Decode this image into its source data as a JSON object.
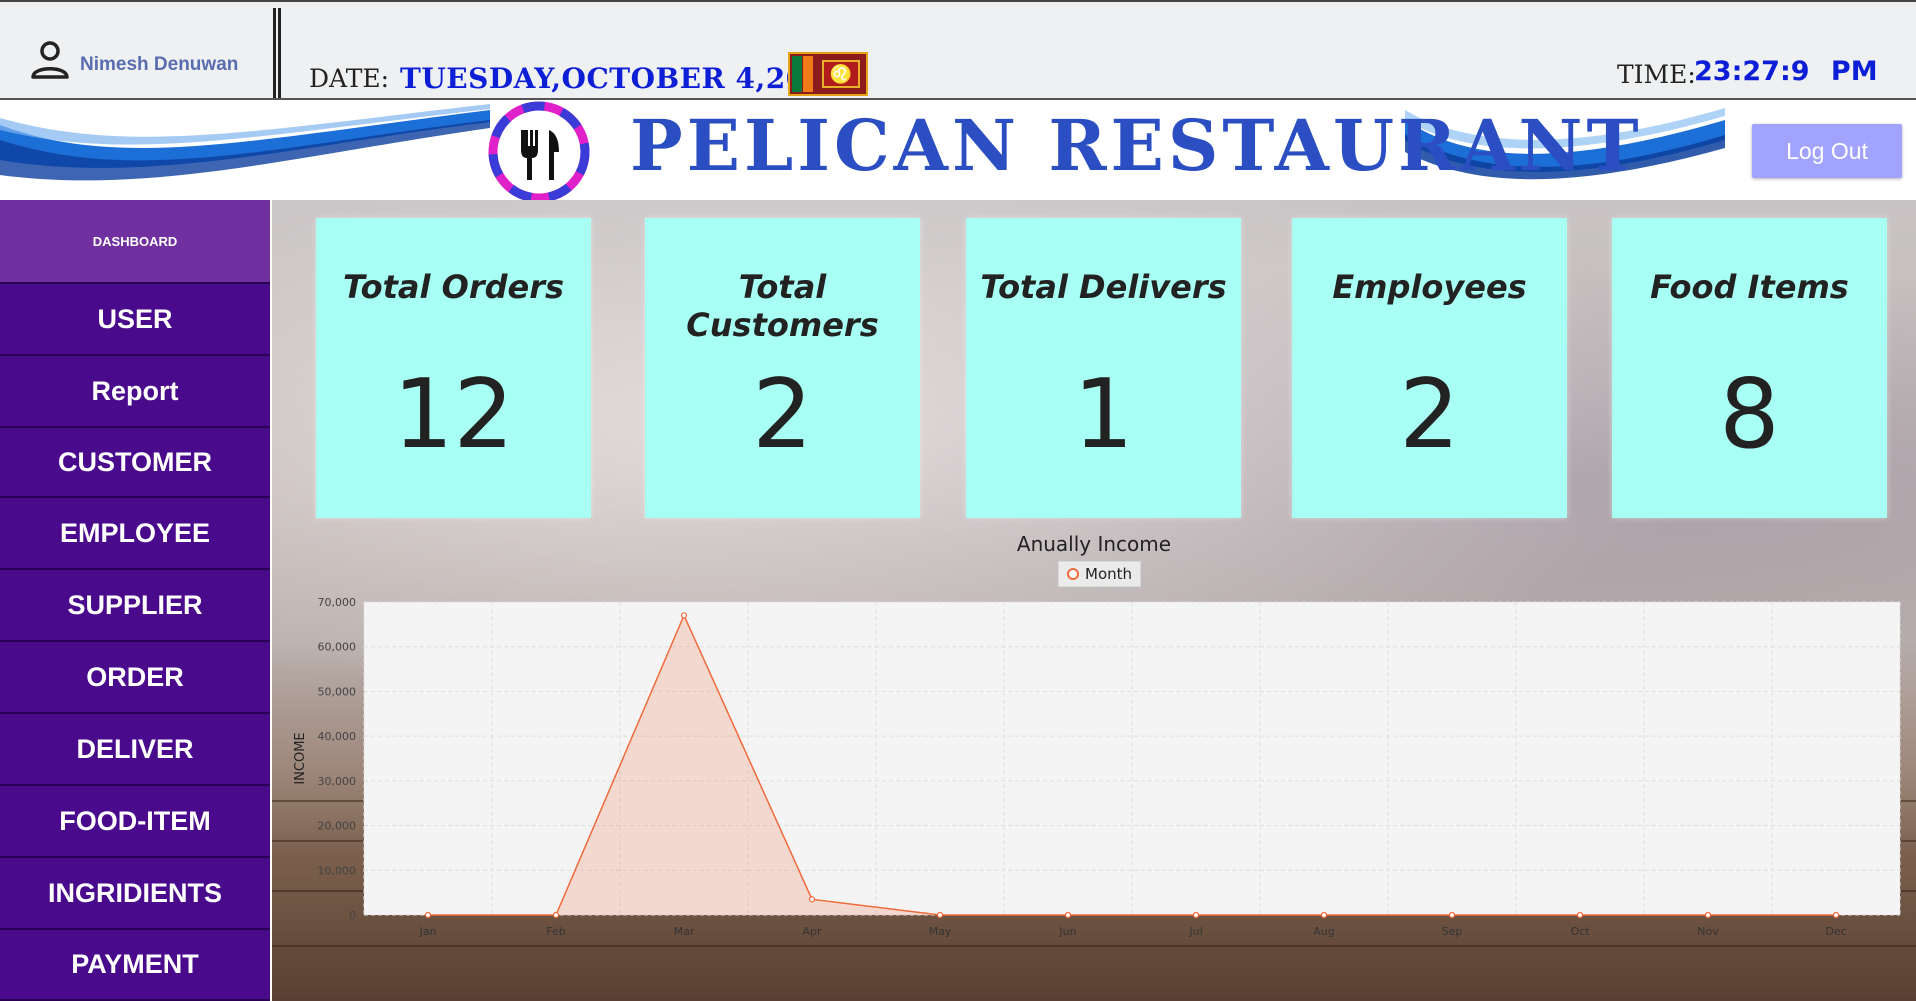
{
  "header": {
    "user_name": "Nimesh Denuwan",
    "date_label": "DATE:",
    "date_value": "TUESDAY,OCTOBER 4,2022",
    "time_label": "TIME:",
    "time_value": "23:27:9  PM"
  },
  "banner": {
    "title": "PELICAN RESTAURANT",
    "logout_label": "Log Out"
  },
  "sidebar": {
    "items": [
      {
        "label": "DASHBOARD"
      },
      {
        "label": "USER"
      },
      {
        "label": "Report"
      },
      {
        "label": "CUSTOMER"
      },
      {
        "label": "EMPLOYEE"
      },
      {
        "label": "SUPPLIER"
      },
      {
        "label": "ORDER"
      },
      {
        "label": "DELIVER"
      },
      {
        "label": "FOOD-ITEM"
      },
      {
        "label": "INGRIDIENTS"
      },
      {
        "label": "PAYMENT"
      }
    ]
  },
  "cards": [
    {
      "title": "Total Orders",
      "value": "12"
    },
    {
      "title": "Total Customers",
      "value": "2"
    },
    {
      "title": "Total Delivers",
      "value": "1"
    },
    {
      "title": "Employees",
      "value": "2"
    },
    {
      "title": "Food Items",
      "value": "8"
    }
  ],
  "colors": {
    "sidebar": "#4a0a8c",
    "sidebar_active": "#7030a0",
    "card": "#a8fff3",
    "accent_text": "#0d1fd6",
    "series": "#f06a3a",
    "logout": "#a2a3ff"
  },
  "chart_data": {
    "type": "area",
    "title": "Anually Income",
    "ylabel": "INCOME",
    "xlabel": "",
    "categories": [
      "Jan",
      "Feb",
      "Mar",
      "Apr",
      "May",
      "Jun",
      "Jul",
      "Aug",
      "Sep",
      "Oct",
      "Nov",
      "Dec"
    ],
    "series": [
      {
        "name": "Month",
        "values": [
          0,
          0,
          67000,
          3500,
          0,
          0,
          0,
          0,
          0,
          0,
          0,
          0
        ]
      }
    ],
    "ylim": [
      0,
      70000
    ],
    "yticks": [
      "0",
      "10,000",
      "20,000",
      "30,000",
      "40,000",
      "50,000",
      "60,000",
      "70,000"
    ],
    "grid": true,
    "legend": "top-center"
  }
}
